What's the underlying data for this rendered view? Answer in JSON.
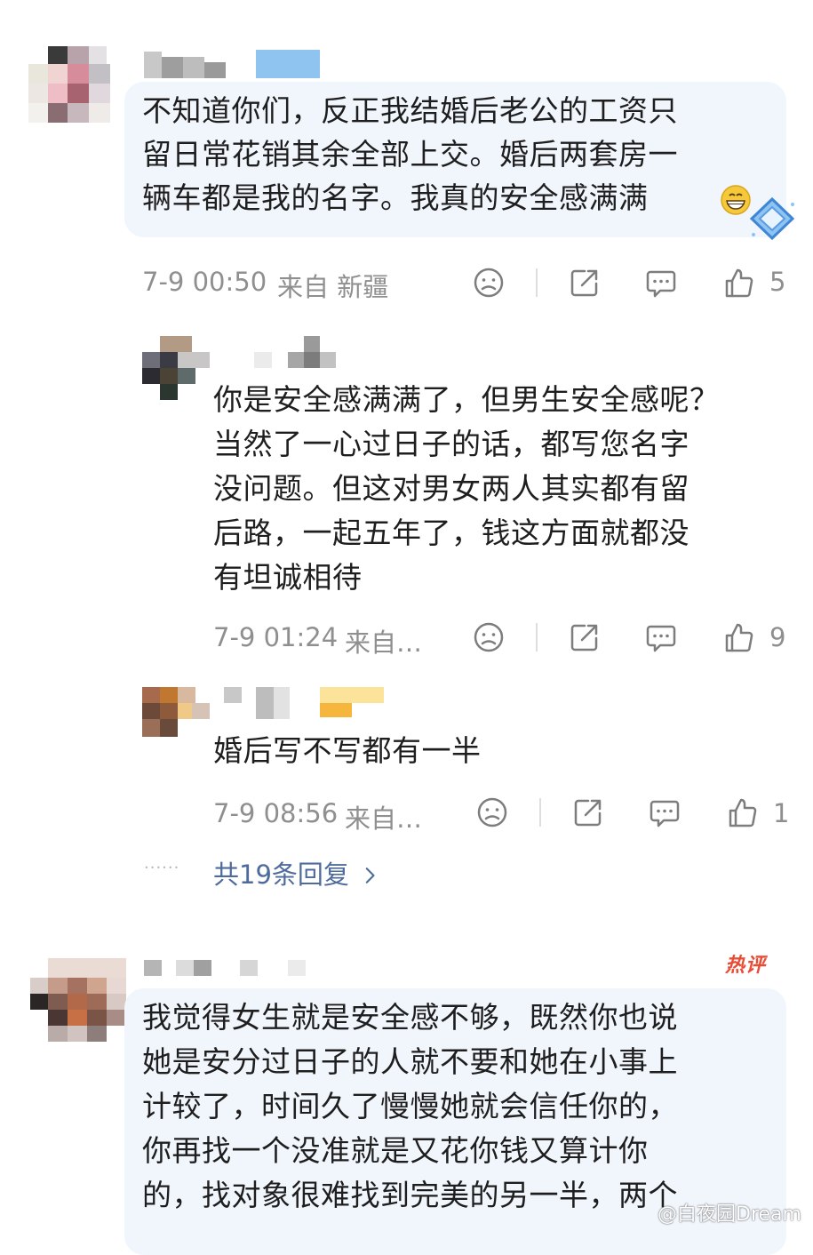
{
  "comments": [
    {
      "text_lines": [
        "不知道你们，反正我结婚后老公的工资只",
        "留日常花销其余全部上交。婚后两套房一",
        "辆车都是我的名字。我真的安全感满满"
      ],
      "emoji_icon": "grin-emoji-icon",
      "badge_icon": "diamond-badge-icon",
      "time": "7-9 00:50",
      "location": "来自 新疆",
      "likes": "5"
    },
    {
      "text_lines": [
        "你是安全感满满了，但男生安全感呢？",
        "当然了一心过日子的话，都写您名字",
        "没问题。但这对男女两人其实都有留",
        "后路，一起五年了，钱这方面就都没",
        "有坦诚相待"
      ],
      "time": "7-9 01:24",
      "location": "来自…",
      "likes": "9"
    },
    {
      "text_lines": [
        "婚后写不写都有一半"
      ],
      "time": "7-9 08:56",
      "location": "来自…",
      "likes": "1"
    },
    {
      "text_lines": [
        "我觉得女生就是安全感不够，既然你也说",
        "她是安分过日子的人就不要和她在小事上",
        "计较了，时间久了慢慢她就会信任你的，",
        "你再找一个没准就是又花你钱又算计你",
        "的，找对象很难找到完美的另一半，两个"
      ],
      "badge": "热评"
    }
  ],
  "more_replies": "共19条回复",
  "more_dots": "······",
  "watermark": "@白夜园Dream",
  "colors": {
    "bubble": "#f1f6fd",
    "meta_gray": "#8f8f8f",
    "link_blue": "#4e6b9c",
    "hot_red": "#e94b35"
  }
}
